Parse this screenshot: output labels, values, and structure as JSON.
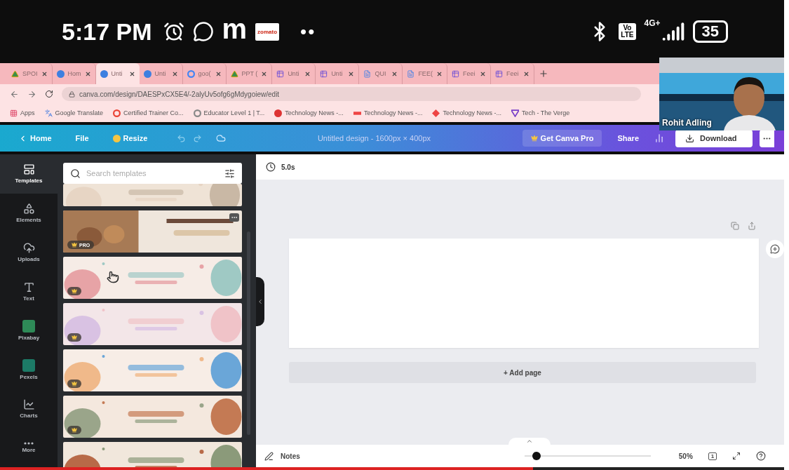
{
  "status_bar": {
    "time": "5:17 PM",
    "notifications": [
      {
        "kind": "alarm"
      },
      {
        "kind": "chat"
      },
      {
        "kind": "letter",
        "label": "m"
      },
      {
        "kind": "logo",
        "label": "zomato"
      }
    ],
    "more": "••",
    "volte_top": "Vo",
    "volte_bottom": "LTE",
    "network": "4G+",
    "battery": "35"
  },
  "tabs": [
    {
      "label": "SPOI",
      "kind": "drive",
      "selected": false
    },
    {
      "label": "Hom",
      "kind": "canva",
      "selected": false
    },
    {
      "label": "Unti",
      "kind": "canva",
      "selected": true
    },
    {
      "label": "Unti",
      "kind": "canva",
      "selected": false
    },
    {
      "label": "goo(",
      "kind": "google",
      "selected": false
    },
    {
      "label": "PPT (",
      "kind": "drive",
      "selected": false
    },
    {
      "label": "Unti",
      "kind": "form",
      "selected": false
    },
    {
      "label": "Unti",
      "kind": "form",
      "selected": false
    },
    {
      "label": "QUI",
      "kind": "doc",
      "selected": false
    },
    {
      "label": "FEE(",
      "kind": "doc",
      "selected": false
    },
    {
      "label": "Feei",
      "kind": "form",
      "selected": false
    },
    {
      "label": "Feei",
      "kind": "form",
      "selected": false
    }
  ],
  "address": "canva.com/design/DAESPxCX5E4/-2alyUv5ofg6gMdygoiew/edit",
  "bookmarks": [
    {
      "label": "Apps",
      "kind": "apps"
    },
    {
      "label": "Google Translate",
      "kind": "translate"
    },
    {
      "label": "Certified Trainer Co...",
      "kind": "google"
    },
    {
      "label": "Educator Level 1 | T...",
      "kind": "google-grey"
    },
    {
      "label": "Technology News -...",
      "kind": "news-red"
    },
    {
      "label": "Technology News -...",
      "kind": "news-logo"
    },
    {
      "label": "Technology News -...",
      "kind": "news-diamond"
    },
    {
      "label": "Tech - The Verge",
      "kind": "verge"
    }
  ],
  "editor_bar": {
    "home": "Home",
    "file": "File",
    "resize": "Resize",
    "title": "Untitled design - 1600px × 400px",
    "pro": "Get Canva Pro",
    "share": "Share",
    "download": "Download"
  },
  "nav": [
    {
      "label": "Templates",
      "kind": "templates",
      "selected": true
    },
    {
      "label": "Elements",
      "kind": "elements",
      "selected": false
    },
    {
      "label": "Uploads",
      "kind": "uploads",
      "selected": false
    },
    {
      "label": "Text",
      "kind": "text",
      "selected": false
    },
    {
      "label": "Pixabay",
      "kind": "pixabay",
      "selected": false
    },
    {
      "label": "Pexels",
      "kind": "pexels",
      "selected": false
    },
    {
      "label": "Charts",
      "kind": "charts",
      "selected": false
    },
    {
      "label": "More",
      "kind": "more",
      "selected": false
    }
  ],
  "templates_panel": {
    "placeholder": "Search templates",
    "templates": [
      {
        "kind": "picture",
        "badge": {
          "kind": "none"
        },
        "menu": false
      },
      {
        "kind": "picture",
        "badge": {
          "kind": "pro",
          "label": "PRO"
        },
        "menu": true
      },
      {
        "kind": "picture",
        "badge": {
          "kind": "crown"
        },
        "menu": false
      },
      {
        "kind": "picture",
        "badge": {
          "kind": "crown"
        },
        "menu": false
      },
      {
        "kind": "picture",
        "badge": {
          "kind": "crown"
        },
        "menu": false
      },
      {
        "kind": "picture",
        "badge": {
          "kind": "crown"
        },
        "menu": false
      },
      {
        "kind": "picture",
        "badge": {
          "kind": "none"
        },
        "menu": false
      }
    ]
  },
  "canvas": {
    "duration": "5.0s",
    "add_page": "+ Add page",
    "notes": "Notes",
    "zoom": {
      "level": 0.06,
      "reading": "50%"
    },
    "page_count": "1"
  },
  "video_tile": {
    "participant": "Rohit Adling"
  },
  "video_progress": {
    "level": 0.68
  }
}
